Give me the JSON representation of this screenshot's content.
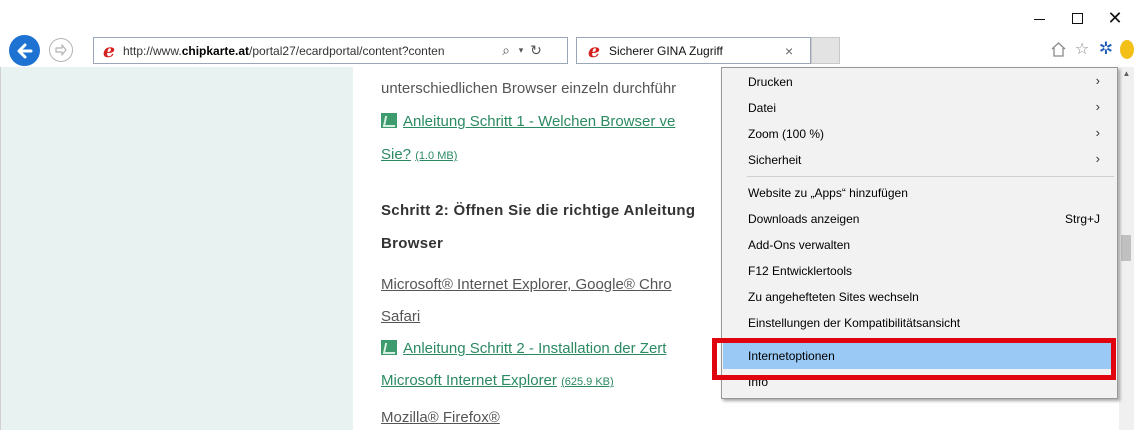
{
  "window": {
    "minimize_icon": "minimize-icon",
    "maximize_icon": "maximize-icon",
    "close_label": "✕"
  },
  "address_bar": {
    "url_prefix": "http://www.",
    "url_domain": "chipkarte.at",
    "url_suffix": "/portal27/ecardportal/content?conten",
    "search_icon": "⌕",
    "dropdown_icon": "▾",
    "refresh_icon": "↻"
  },
  "tab": {
    "title": "Sicherer GINA Zugriff",
    "close": "×"
  },
  "content": {
    "line1": "unterschiedlichen Browser einzeln durchführ",
    "link1_text": "Anleitung Schritt 1 - Welchen Browser ve",
    "link1_cont": "Sie?",
    "link1_size": "(1.0 MB)",
    "heading2_a": "Schritt 2: Öffnen Sie die richtige Anleitung",
    "heading2_b": "Browser",
    "browsers_a": "Microsoft® Internet Explorer, Google® Chro",
    "browsers_b": "Safari",
    "link2_text": "Anleitung Schritt 2 - Installation der Zert",
    "link2_cont": "Microsoft Internet Explorer",
    "link2_size": "(625.9 KB)",
    "firefox": "Mozilla® Firefox®"
  },
  "menu": {
    "items": [
      {
        "label": "Drucken",
        "arrow": "›"
      },
      {
        "label": "Datei",
        "arrow": "›"
      },
      {
        "label": "Zoom (100 %)",
        "arrow": "›"
      },
      {
        "label": "Sicherheit",
        "arrow": "›"
      },
      {
        "label": "Website zu „Apps“ hinzufügen"
      },
      {
        "label": "Downloads anzeigen",
        "shortcut": "Strg+J"
      },
      {
        "label": "Add-Ons verwalten"
      },
      {
        "label": "F12 Entwicklertools"
      },
      {
        "label": "Zu angehefteten Sites wechseln"
      },
      {
        "label": "Einstellungen der Kompatibilitätsansicht"
      },
      {
        "label": "Internetoptionen"
      },
      {
        "label": "Info"
      }
    ]
  },
  "colors": {
    "highlight": "#99c9f4",
    "annotation_box": "#e0040f",
    "link_green": "#2b8a62"
  }
}
